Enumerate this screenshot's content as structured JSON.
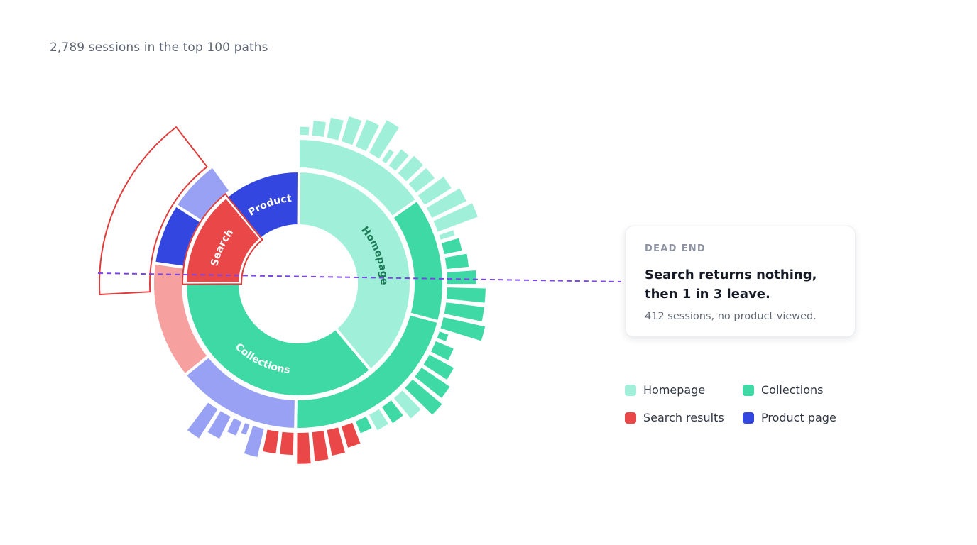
{
  "subtitle": "2,789 sessions in the top 100 paths",
  "chart_data": {
    "type": "sunburst",
    "inner_ring": [
      {
        "name": "Homepage",
        "share": 0.389,
        "color": "#a0f0d9",
        "label": "Homepage",
        "label_color": "#1d7a57"
      },
      {
        "name": "Collections",
        "share": 0.362,
        "color": "#3fd9a5",
        "label": "Collections",
        "label_color": "#ffffff"
      },
      {
        "name": "Search results",
        "share": 0.139,
        "color": "#ea4848",
        "label": "Search",
        "label_color": "#ffffff"
      },
      {
        "name": "Product page",
        "share": 0.111,
        "color": "#3346e0",
        "label": "Product",
        "label_color": "#ffffff"
      }
    ],
    "middle_ring": [
      {
        "parent": "Homepage",
        "share": 0.152,
        "color": "#a0f0d9"
      },
      {
        "parent": "Homepage",
        "share": 0.14,
        "color": "#3fd9a5"
      },
      {
        "parent": "Collections",
        "share": 0.211,
        "color": "#3fd9a5"
      },
      {
        "parent": "Collections",
        "share": 0.139,
        "color": "#98a1f3"
      },
      {
        "parent": "Search results",
        "share": 0.131,
        "color": "#f6a09f"
      },
      {
        "parent": "Product page",
        "share": 0.068,
        "color": "#3346e0"
      },
      {
        "parent": "Product page",
        "share": 0.059,
        "color": "#98a1f3"
      }
    ],
    "outer_bars": [
      {
        "share": 0.013,
        "color": "#a0f0d9",
        "height": 0.19
      },
      {
        "share": 0.016,
        "color": "#a0f0d9",
        "height": 0.35
      },
      {
        "share": 0.016,
        "color": "#a0f0d9",
        "height": 0.48
      },
      {
        "share": 0.016,
        "color": "#a0f0d9",
        "height": 0.61
      },
      {
        "share": 0.016,
        "color": "#a0f0d9",
        "height": 0.68
      },
      {
        "share": 0.016,
        "color": "#a0f0d9",
        "height": 0.87
      },
      {
        "share": 0.009,
        "color": "#a0f0d9",
        "height": 0.32
      },
      {
        "share": 0.013,
        "color": "#a0f0d9",
        "height": 0.48
      },
      {
        "share": 0.016,
        "color": "#a0f0d9",
        "height": 0.55
      },
      {
        "share": 0.016,
        "color": "#a0f0d9",
        "height": 0.55
      },
      {
        "share": 0.016,
        "color": "#a0f0d9",
        "height": 0.74
      },
      {
        "share": 0.016,
        "color": "#a0f0d9",
        "height": 0.9
      },
      {
        "share": 0.016,
        "color": "#a0f0d9",
        "height": 1.0
      },
      {
        "share": 0.009,
        "color": "#a0f0d9",
        "height": 0.35
      },
      {
        "share": 0.016,
        "color": "#3fd9a5",
        "height": 0.42
      },
      {
        "share": 0.016,
        "color": "#3fd9a5",
        "height": 0.52
      },
      {
        "share": 0.016,
        "color": "#3fd9a5",
        "height": 0.68
      },
      {
        "share": 0.016,
        "color": "#3fd9a5",
        "height": 0.9
      },
      {
        "share": 0.016,
        "color": "#3fd9a5",
        "height": 0.9
      },
      {
        "share": 0.016,
        "color": "#3fd9a5",
        "height": 1.0
      },
      {
        "share": 0.011,
        "color": "#3fd9a5",
        "height": 0.22
      },
      {
        "share": 0.016,
        "color": "#3fd9a5",
        "height": 0.45
      },
      {
        "share": 0.016,
        "color": "#3fd9a5",
        "height": 0.65
      },
      {
        "share": 0.016,
        "color": "#3fd9a5",
        "height": 0.8
      },
      {
        "share": 0.016,
        "color": "#3fd9a5",
        "height": 0.9
      },
      {
        "share": 0.016,
        "color": "#a0f0d9",
        "height": 0.62
      },
      {
        "share": 0.016,
        "color": "#3fd9a5",
        "height": 0.45
      },
      {
        "share": 0.016,
        "color": "#a0f0d9",
        "height": 0.41
      },
      {
        "share": 0.016,
        "color": "#3fd9a5",
        "height": 0.3
      },
      {
        "share": 0.016,
        "color": "#ea4848",
        "height": 0.52
      },
      {
        "share": 0.016,
        "color": "#ea4848",
        "height": 0.61
      },
      {
        "share": 0.016,
        "color": "#ea4848",
        "height": 0.68
      },
      {
        "share": 0.016,
        "color": "#ea4848",
        "height": 0.73
      },
      {
        "share": 0.016,
        "color": "#ea4848",
        "height": 0.52
      },
      {
        "share": 0.016,
        "color": "#ea4848",
        "height": 0.52
      },
      {
        "share": 0.016,
        "color": "#98a1f3",
        "height": 0.68
      },
      {
        "share": 0.009,
        "color": "#98a1f3",
        "height": 0.25
      },
      {
        "share": 0.013,
        "color": "#98a1f3",
        "height": 0.35
      },
      {
        "share": 0.016,
        "color": "#98a1f3",
        "height": 0.58
      },
      {
        "share": 0.016,
        "color": "#98a1f3",
        "height": 0.81
      }
    ],
    "highlight": {
      "segment": "Search results",
      "color": "#e03c3c",
      "guide_color": "#7b46e8"
    }
  },
  "callout": {
    "eyebrow": "DEAD END",
    "title_line1": "Search returns nothing,",
    "title_line2": "then 1 in 3 leave.",
    "note": "412 sessions, no product viewed."
  },
  "legend": [
    {
      "label": "Homepage",
      "color": "#a0f0d9"
    },
    {
      "label": "Collections",
      "color": "#3fd9a5"
    },
    {
      "label": "Search results",
      "color": "#ea4848"
    },
    {
      "label": "Product page",
      "color": "#3346e0"
    }
  ]
}
